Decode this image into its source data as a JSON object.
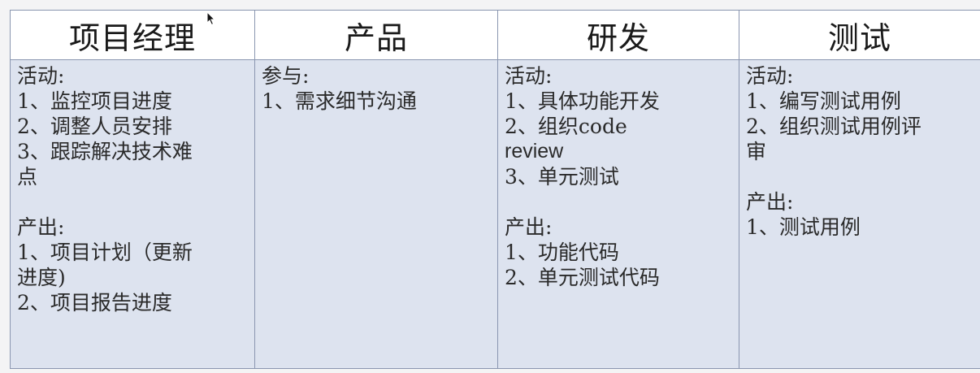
{
  "columns": [
    {
      "header": "项目经理",
      "blocks": [
        {
          "lines": [
            "活动:",
            "1、监控项目进度",
            "2、调整人员安排",
            "3、跟踪解决技术难",
            "点"
          ]
        },
        {
          "lines": [
            "产出:",
            "1、项目计划（更新",
            "进度)",
            "2、项目报告进度"
          ]
        }
      ]
    },
    {
      "header": "产品",
      "blocks": [
        {
          "lines": [
            "参与:",
            "1、需求细节沟通"
          ]
        }
      ]
    },
    {
      "header": "研发",
      "blocks": [
        {
          "lines": [
            "活动:",
            "1、具体功能开发",
            "2、组织code",
            "review",
            "3、单元测试"
          ]
        },
        {
          "lines": [
            "产出:",
            "1、功能代码",
            "2、单元测试代码"
          ]
        }
      ]
    },
    {
      "header": "测试",
      "blocks": [
        {
          "lines": [
            "活动:",
            "1、编写测试用例",
            "2、组织测试用例评",
            "审"
          ]
        },
        {
          "lines": [
            "产出:",
            "1、测试用例"
          ]
        }
      ]
    }
  ],
  "colors": {
    "header_bg": "#ffffff",
    "body_bg": "#dde3ef",
    "border": "#8a96b0",
    "text": "#1a1a1a"
  }
}
